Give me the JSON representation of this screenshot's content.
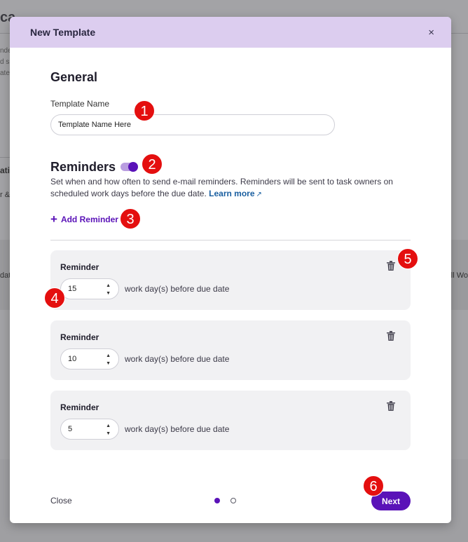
{
  "background": {
    "title_fragment": "ca",
    "side_lines": [
      "nde",
      "d s",
      "ate"
    ],
    "section_fragment": "ati",
    "row_fragment": "r &",
    "left_cell": "dat",
    "right_cell": "ll Wo"
  },
  "modal": {
    "title": "New Template",
    "close_label": "×",
    "general": {
      "title": "General",
      "template_name_label": "Template Name",
      "template_name_value": "Template Name Here"
    },
    "reminders": {
      "title": "Reminders",
      "toggle_on": true,
      "description": "Set when and how often to send e-mail reminders. Reminders will be sent to task owners on scheduled work days before the due date.",
      "learn_more": "Learn more",
      "add_reminder": "Add Reminder",
      "items": [
        {
          "label": "Reminder",
          "value": "15",
          "unit_text": "work day(s) before due date"
        },
        {
          "label": "Reminder",
          "value": "10",
          "unit_text": "work day(s) before due date"
        },
        {
          "label": "Reminder",
          "value": "5",
          "unit_text": "work day(s) before due date"
        }
      ]
    },
    "footer": {
      "close": "Close",
      "next": "Next",
      "page_current": 1,
      "page_total": 2
    }
  },
  "callouts": [
    "1",
    "2",
    "3",
    "4",
    "5",
    "6"
  ],
  "colors": {
    "accent": "#5a12b8",
    "header_bg": "#dccdef",
    "callout": "#e40f0f",
    "link": "#1a5fa0"
  }
}
